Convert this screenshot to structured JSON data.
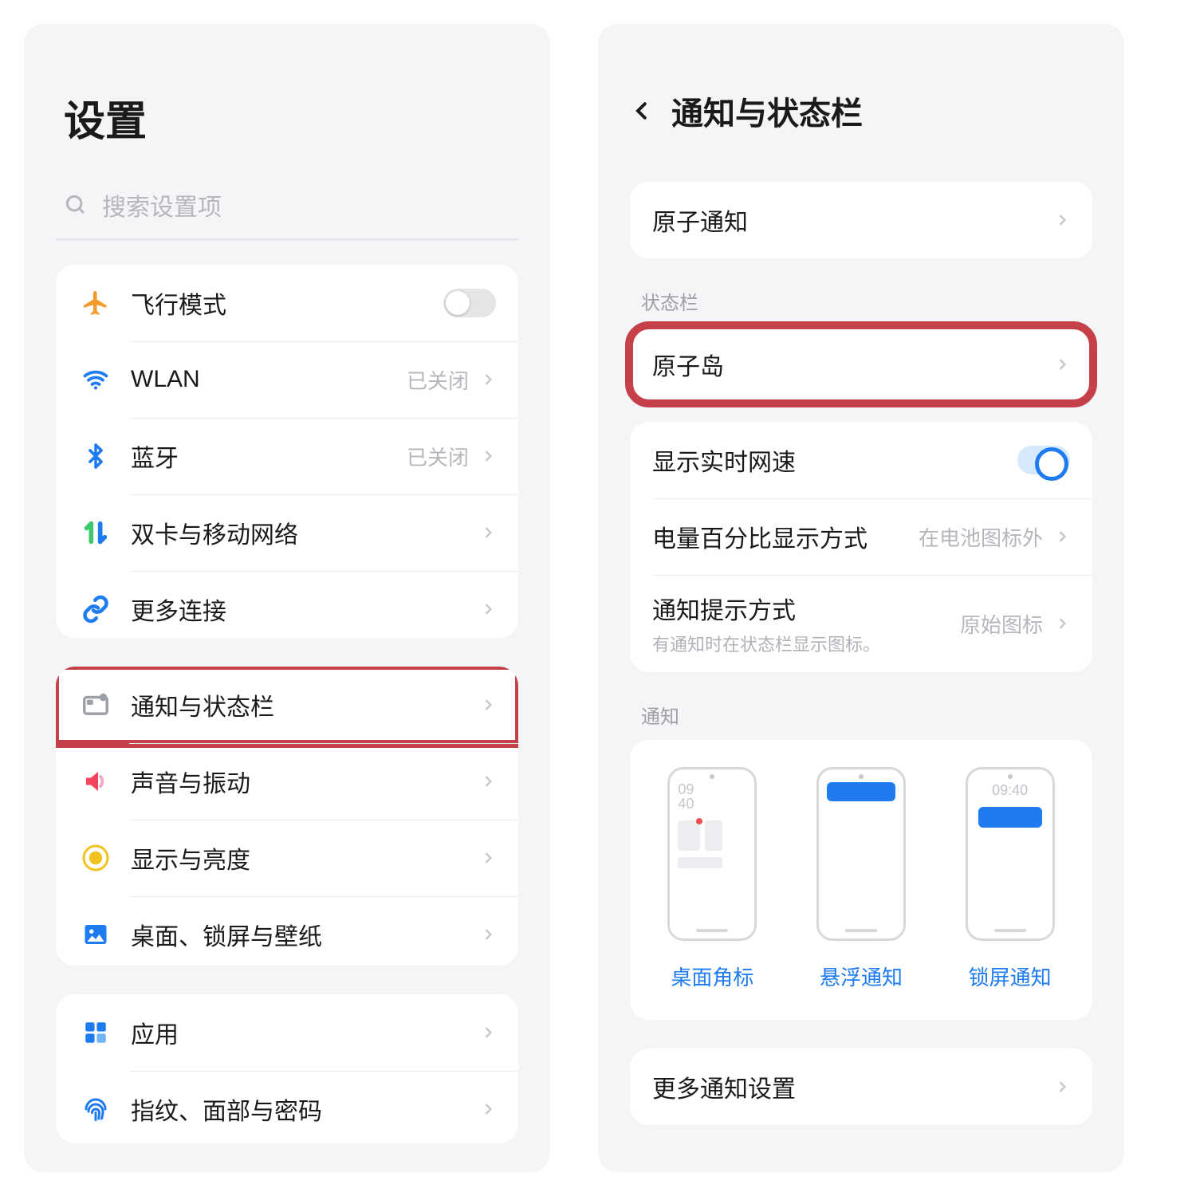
{
  "left": {
    "title": "设置",
    "search_placeholder": "搜索设置项",
    "g1": {
      "airplane": "飞行模式",
      "wlan": "WLAN",
      "wlan_status": "已关闭",
      "bluetooth": "蓝牙",
      "bluetooth_status": "已关闭",
      "dualsim": "双卡与移动网络",
      "more_conn": "更多连接"
    },
    "g2": {
      "notif_status": "通知与状态栏",
      "sound": "声音与振动",
      "display": "显示与亮度",
      "wallpaper": "桌面、锁屏与壁纸"
    },
    "g3": {
      "apps": "应用",
      "biometrics": "指纹、面部与密码"
    }
  },
  "right": {
    "title": "通知与状态栏",
    "atom_notif": "原子通知",
    "sec_status": "状态栏",
    "atom_island": "原子岛",
    "net_speed": "显示实时网速",
    "battery_pct": "电量百分比显示方式",
    "battery_pct_val": "在电池图标外",
    "notif_style": "通知提示方式",
    "notif_style_sub": "有通知时在状态栏显示图标。",
    "notif_style_val": "原始图标",
    "sec_notif": "通知",
    "preview1": "桌面角标",
    "preview2": "悬浮通知",
    "preview3": "锁屏通知",
    "preview_clock1a": "09",
    "preview_clock1b": "40",
    "preview_clock3": "09:40",
    "more_notif": "更多通知设置"
  }
}
